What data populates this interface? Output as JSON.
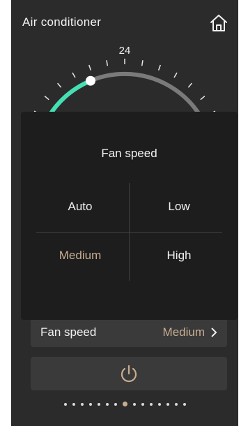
{
  "header": {
    "title": "Air conditioner",
    "home_icon": "home-icon"
  },
  "thermostat": {
    "setpoint": "24",
    "min": 16,
    "max": 32,
    "current": 21,
    "accent_color": "#44e0b3",
    "track_color": "#7a7a7a"
  },
  "modal": {
    "title": "Fan speed",
    "options": [
      "Auto",
      "Low",
      "Medium",
      "High"
    ],
    "selected": "Medium"
  },
  "controls": {
    "fan_speed_label": "Fan speed",
    "fan_speed_value": "Medium",
    "chevron_icon": "chevron-right-icon",
    "power_icon": "power-icon"
  },
  "pager": {
    "count": 15,
    "active_index": 7
  },
  "colors": {
    "background": "#2b2b2b",
    "panel": "#1d1d1d",
    "selected_text": "#c7ad91"
  }
}
